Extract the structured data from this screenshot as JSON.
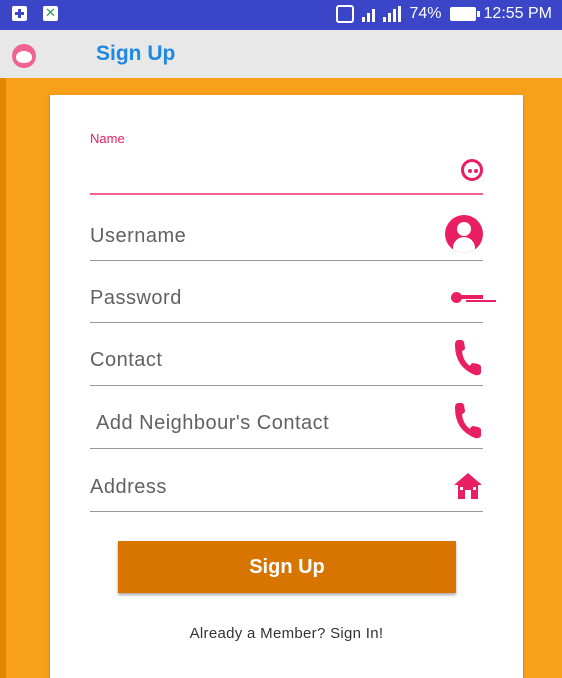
{
  "status_bar": {
    "battery_percent": "74%",
    "time": "12:55 PM",
    "icons": [
      "clipboard-plus-icon",
      "x-app-icon",
      "vibrate-icon",
      "signal-icon",
      "signal-icon",
      "battery-icon"
    ]
  },
  "toolbar": {
    "title": "Sign Up",
    "icon": "face-icon"
  },
  "form": {
    "name": {
      "label": "Name",
      "value": "",
      "icon": "face-icon"
    },
    "username": {
      "placeholder": "Username",
      "icon": "user-icon"
    },
    "password": {
      "placeholder": "Password",
      "icon": "key-icon"
    },
    "contact": {
      "placeholder": "Contact",
      "icon": "phone-icon"
    },
    "neighbour_contact": {
      "placeholder": "Add Neighbour's Contact",
      "icon": "phone-icon"
    },
    "address": {
      "placeholder": "Address",
      "icon": "home-icon"
    }
  },
  "actions": {
    "signup_label": "Sign Up",
    "signin_link": "Already a Member? Sign In!"
  },
  "colors": {
    "status_bar": "#3a45c8",
    "toolbar_bg": "#e8e8e8",
    "title": "#1e88e5",
    "background": "#f9a01b",
    "accent": "#e91e63",
    "button": "#d87500"
  }
}
